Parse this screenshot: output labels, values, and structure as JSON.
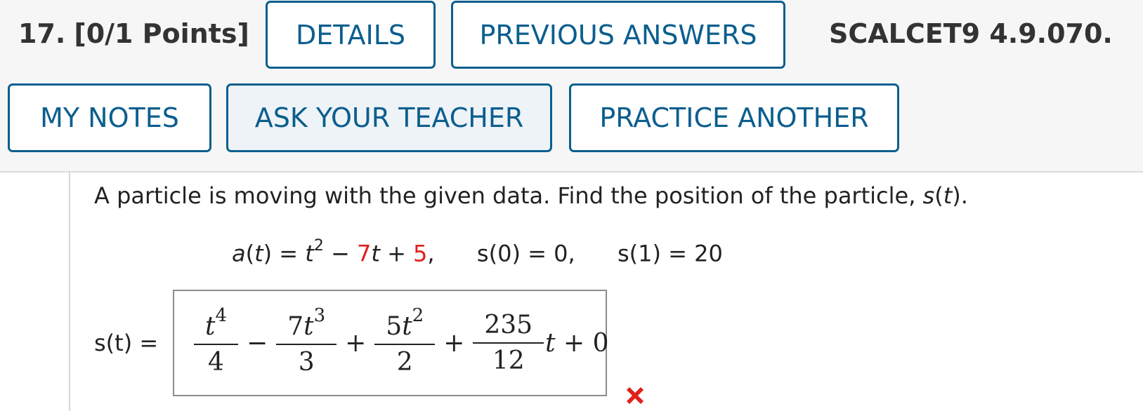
{
  "header": {
    "question_number": "17.",
    "points": "[0/1 Points]",
    "details_label": "DETAILS",
    "previous_answers_label": "PREVIOUS ANSWERS",
    "reference": "SCALCET9 4.9.070.",
    "my_notes_label": "MY NOTES",
    "ask_teacher_label": "ASK YOUR TEACHER",
    "practice_another_label": "PRACTICE ANOTHER"
  },
  "problem": {
    "prompt_text": "A particle is moving with the given data. Find the position of the particle, ",
    "prompt_func": "s",
    "prompt_paren_open": "(",
    "prompt_var": "t",
    "prompt_end": ").",
    "given": {
      "a_label": "a",
      "t_var": "t",
      "eq_prefix": ") = ",
      "t2": "t",
      "exp2": "2",
      "minus": " − ",
      "coef_red": "7",
      "plus": " + ",
      "const_red": "5",
      "comma": ",",
      "s0": "s(0) = 0,",
      "s1": "s(1) = 20"
    }
  },
  "answer": {
    "label": "s(t) =",
    "term1_num_var": "t",
    "term1_num_exp": "4",
    "term1_den": "4",
    "op1": "−",
    "term2_num_coef": "7",
    "term2_num_var": "t",
    "term2_num_exp": "3",
    "term2_den": "3",
    "op2": "+",
    "term3_num_coef": "5",
    "term3_num_var": "t",
    "term3_num_exp": "2",
    "term3_den": "2",
    "op3": "+",
    "term4_num": "235",
    "term4_den": "12",
    "tail_var": "t",
    "tail_rest": " + 0",
    "status": "incorrect",
    "status_color": "#e0201a"
  },
  "colors": {
    "button_border": "#0b5e8e",
    "red_highlight": "#e0201a"
  }
}
